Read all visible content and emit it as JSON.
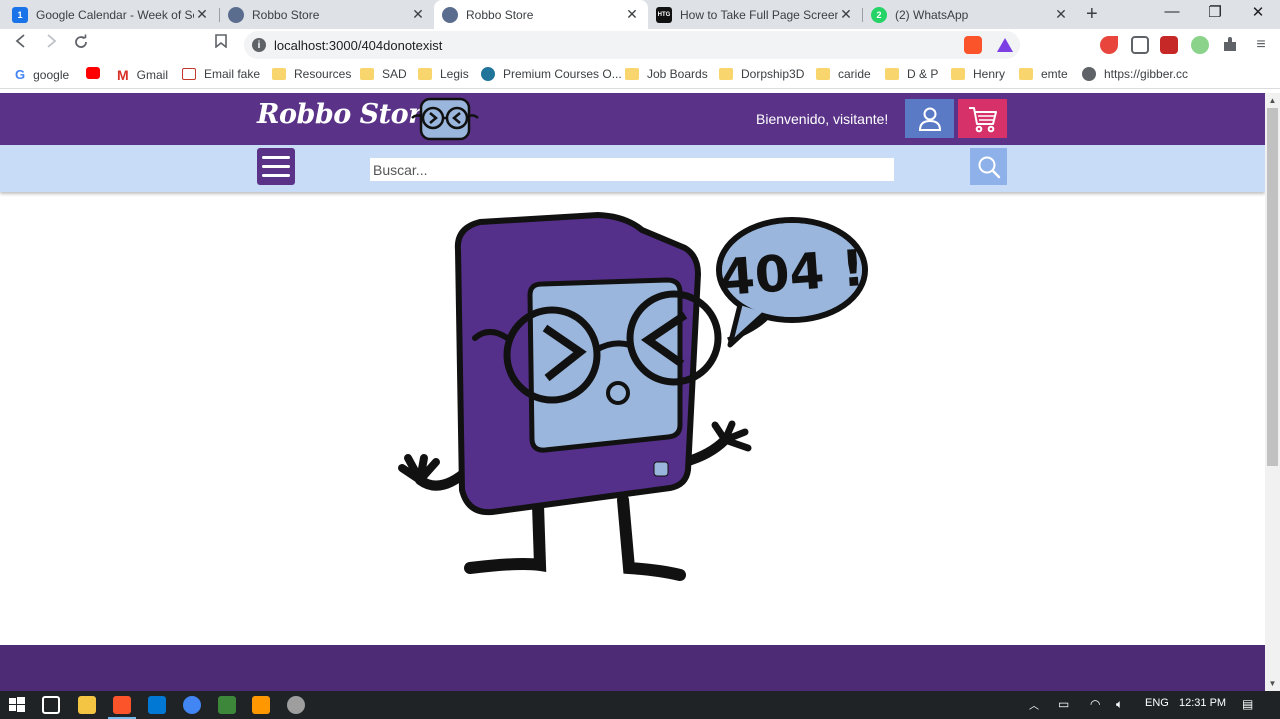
{
  "browser": {
    "tabs": [
      {
        "title": "Google Calendar - Week of Septe",
        "favicon": "calendar-icon",
        "color": "#1a73e8",
        "glyph": "1"
      },
      {
        "title": "Robbo Store",
        "favicon": "robbo-icon",
        "color": "#5b6d8f",
        "glyph": ""
      },
      {
        "title": "Robbo Store",
        "favicon": "robbo-icon",
        "color": "#5b6d8f",
        "glyph": ""
      },
      {
        "title": "How to Take Full Page Screensho",
        "favicon": "htg-icon",
        "color": "#111111",
        "glyph": "HTG"
      },
      {
        "title": "(2) WhatsApp",
        "favicon": "whatsapp-icon",
        "color": "#25d366",
        "glyph": "2"
      }
    ],
    "active_tab": 2,
    "address": "localhost:3000/404donotexist",
    "bookmarks": [
      {
        "label": "google",
        "icon": "google-icon",
        "kind": "google"
      },
      {
        "label": "",
        "icon": "youtube-icon",
        "kind": "youtube"
      },
      {
        "label": "Gmail",
        "icon": "gmail-icon",
        "kind": "gmail"
      },
      {
        "label": "Email fake",
        "icon": "mail-icon",
        "kind": "mail"
      },
      {
        "label": "Resources",
        "icon": "folder-icon",
        "kind": "folder"
      },
      {
        "label": "SAD",
        "icon": "folder-icon",
        "kind": "folder"
      },
      {
        "label": "Legis",
        "icon": "folder-icon",
        "kind": "folder"
      },
      {
        "label": "Premium Courses O...",
        "icon": "wordpress-icon",
        "kind": "wordpress"
      },
      {
        "label": "Job Boards",
        "icon": "folder-icon",
        "kind": "folder"
      },
      {
        "label": "Dorpship3D",
        "icon": "folder-icon",
        "kind": "folder"
      },
      {
        "label": "caride",
        "icon": "folder-icon",
        "kind": "folder"
      },
      {
        "label": "D & P",
        "icon": "folder-icon",
        "kind": "folder"
      },
      {
        "label": "Henry",
        "icon": "folder-icon",
        "kind": "folder"
      },
      {
        "label": "emte",
        "icon": "folder-icon",
        "kind": "folder"
      },
      {
        "label": "https://gibber.cc",
        "icon": "globe-icon",
        "kind": "globe"
      }
    ]
  },
  "site": {
    "brand": "Robbo Store",
    "welcome": "Bienvenido, visitante!",
    "search_placeholder": "Buscar...",
    "error_bubble": "404 !",
    "colors": {
      "header": "#5a3388",
      "subbar": "#c9dcf7",
      "user_button": "#5b7ac6",
      "cart_button": "#d63169",
      "search_button": "#8fb1ea",
      "footer": "#4d2b75",
      "robot_body": "#55308a",
      "robot_screen": "#9ab6dc"
    }
  },
  "taskbar": {
    "apps": [
      "start-icon",
      "task-view-icon",
      "file-explorer-icon",
      "brave-icon",
      "vscode-icon",
      "chrome-icon",
      "gitbash-icon",
      "sublime-icon",
      "paint-icon"
    ],
    "language": "ENG",
    "time": "12:31 PM"
  }
}
